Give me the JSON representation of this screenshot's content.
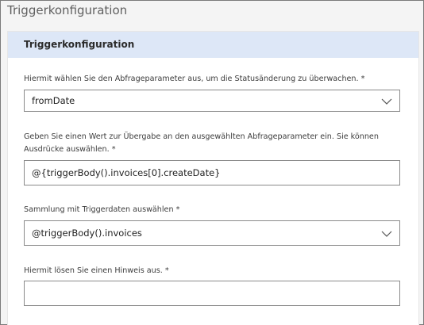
{
  "window": {
    "title": "Triggerkonfiguration"
  },
  "panel": {
    "title": "Triggerkonfiguration"
  },
  "fields": [
    {
      "label": "Hiermit wählen Sie den Abfrageparameter aus, um die Statusänderung zu überwachen.",
      "required_mark": "*",
      "type": "dropdown",
      "value": "fromDate",
      "icon": "chevron-down-icon"
    },
    {
      "label": "Geben Sie einen Wert zur Übergabe an den ausgewählten Abfrageparameter ein. Sie können Ausdrücke auswählen.",
      "required_mark": "*",
      "type": "text",
      "value": "@{triggerBody().invoices[0].createDate}"
    },
    {
      "label": "Sammlung mit Triggerdaten auswählen",
      "required_mark": "*",
      "type": "dropdown",
      "value": "@triggerBody().invoices",
      "icon": "chevron-down-icon"
    },
    {
      "label": "Hiermit lösen Sie einen Hinweis aus.",
      "required_mark": "*",
      "type": "text",
      "value": ""
    }
  ],
  "colors": {
    "header_background": "#dde7f7",
    "field_border": "#8a8a8a",
    "dialog_background": "#f4f4f4"
  }
}
